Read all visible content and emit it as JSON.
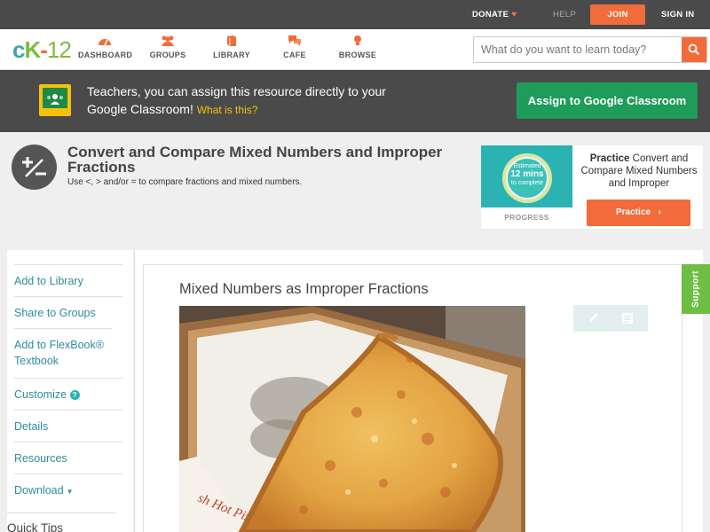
{
  "topbar": {
    "donate": "DONATE",
    "help": "HELP",
    "join": "JOIN",
    "signin": "SIGN IN"
  },
  "nav": {
    "logo": {
      "c": "c",
      "k": "K",
      "dash": "-",
      "n": "12"
    },
    "items": [
      {
        "label": "DASHBOARD",
        "icon": "dashboard-icon"
      },
      {
        "label": "GROUPS",
        "icon": "groups-icon"
      },
      {
        "label": "LIBRARY",
        "icon": "library-icon"
      },
      {
        "label": "CAFE",
        "icon": "cafe-icon"
      },
      {
        "label": "BROWSE",
        "icon": "browse-icon"
      }
    ],
    "search_placeholder": "What do you want to learn today?"
  },
  "banner": {
    "message": "Teachers, you can assign this resource directly to your Google Classroom!",
    "what_link": "What is this?",
    "assign_button": "Assign to Google Classroom"
  },
  "lesson": {
    "title": "Convert and Compare Mixed Numbers and Improper Fractions",
    "subtitle": "Use <, > and/or = to compare fractions and mixed numbers."
  },
  "practice_card": {
    "estimated": "Estimated",
    "mins": "12 mins",
    "to_complete": "to complete",
    "progress_label": "PROGRESS",
    "practice_word": "Practice",
    "practice_title": "Convert and Compare Mixed Numbers and Improper",
    "button": "Practice"
  },
  "sidebar": {
    "items": [
      {
        "label": "Add to Library"
      },
      {
        "label": "Share to Groups"
      },
      {
        "label": "Add to FlexBook® Textbook"
      },
      {
        "label": "Customize"
      },
      {
        "label": "Details"
      },
      {
        "label": "Resources"
      },
      {
        "label": "Download"
      }
    ],
    "quick_tips": "Quick Tips"
  },
  "content": {
    "section_title": "Mixed Numbers as Improper Fractions",
    "box_print": "sh Hot Piz",
    "support_tab": "Support"
  },
  "colors": {
    "accent_orange": "#f26b3a",
    "brand_teal": "#2bb3b3",
    "classroom_green": "#1d9c5a",
    "support_green": "#6fbe44",
    "dark_bar": "#4a4a4a"
  }
}
